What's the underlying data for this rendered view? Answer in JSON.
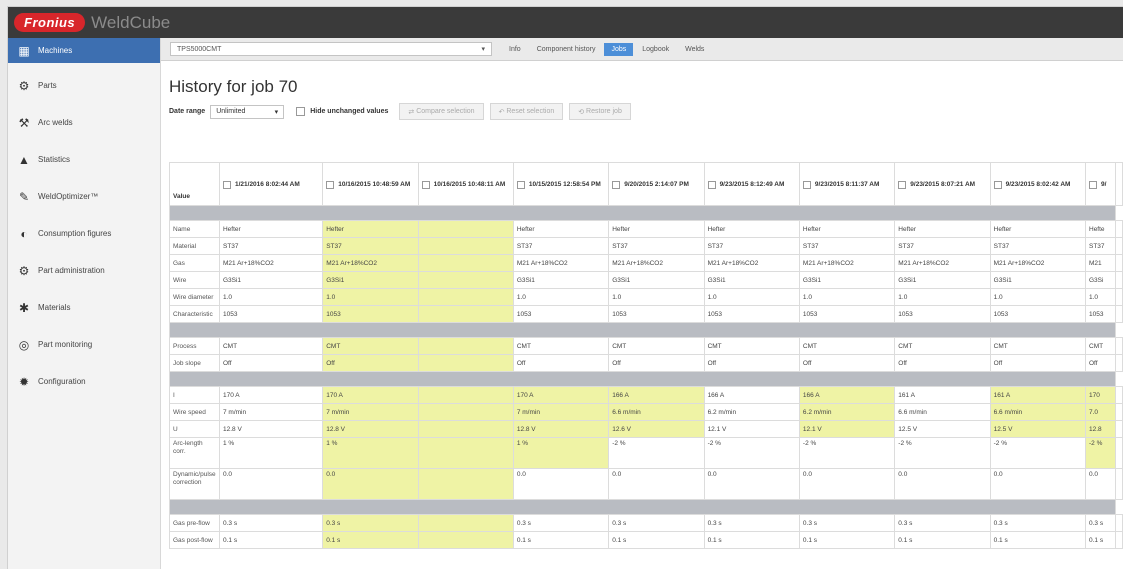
{
  "app": {
    "logo": "Fronius",
    "name": "WeldCube"
  },
  "sidebar": {
    "items": [
      {
        "icon": "machines-icon",
        "label": "Machines",
        "active": true
      },
      {
        "icon": "parts-icon",
        "label": "Parts"
      },
      {
        "icon": "arc-welds-icon",
        "label": "Arc welds"
      },
      {
        "icon": "statistics-icon",
        "label": "Statistics"
      },
      {
        "icon": "weldoptimizer-icon",
        "label": "WeldOptimizer™"
      },
      {
        "icon": "consumption-icon",
        "label": "Consumption figures"
      },
      {
        "icon": "part-administration-icon",
        "label": "Part administration"
      },
      {
        "icon": "materials-icon",
        "label": "Materials"
      },
      {
        "icon": "part-monitoring-icon",
        "label": "Part monitoring"
      },
      {
        "icon": "configuration-icon",
        "label": "Configuration"
      }
    ]
  },
  "toolbar": {
    "machine": "TPS5000CMT",
    "tabs": [
      {
        "label": "Info"
      },
      {
        "label": "Component history"
      },
      {
        "label": "Jobs",
        "active": true
      },
      {
        "label": "Logbook"
      },
      {
        "label": "Welds"
      }
    ]
  },
  "page": {
    "title": "History for job 70",
    "date_range_label": "Date range",
    "date_range_value": "Unlimited",
    "hide_unchanged_label": "Hide unchanged values",
    "buttons": [
      "Compare selection",
      "Reset selection",
      "Restore job"
    ]
  },
  "table": {
    "value_header": "Value",
    "columns": [
      {
        "date": "1/21/2016 8:02:44 AM",
        "highlight": false
      },
      {
        "date": "10/16/2015 10:48:59 AM",
        "highlight": true
      },
      {
        "date": "10/16/2015 10:48:11 AM",
        "highlight": true
      },
      {
        "date": "10/15/2015 12:58:54 PM",
        "highlight": false
      },
      {
        "date": "9/20/2015 2:14:07 PM",
        "highlight": false
      },
      {
        "date": "9/23/2015 8:12:49 AM",
        "highlight": false
      },
      {
        "date": "9/23/2015 8:11:37 AM",
        "highlight": false
      },
      {
        "date": "9/23/2015 8:07:21 AM",
        "highlight": false
      },
      {
        "date": "9/23/2015 8:02:42 AM",
        "highlight": false
      },
      {
        "date": "9/",
        "highlight": false
      }
    ],
    "sections": [
      {
        "title": "",
        "rows": [
          {
            "label": "Name",
            "values": [
              "Hefter",
              "Hefter",
              "",
              "Hefter",
              "Hefter",
              "Hefter",
              "Hefter",
              "Hefter",
              "Hefter",
              "Hefte"
            ]
          },
          {
            "label": "Material",
            "values": [
              "ST37",
              "ST37",
              "",
              "ST37",
              "ST37",
              "ST37",
              "ST37",
              "ST37",
              "ST37",
              "ST37"
            ]
          },
          {
            "label": "Gas",
            "values": [
              "M21 Ar+18%CO2",
              "M21 Ar+18%CO2",
              "",
              "M21 Ar+18%CO2",
              "M21 Ar+18%CO2",
              "M21 Ar+18%CO2",
              "M21 Ar+18%CO2",
              "M21 Ar+18%CO2",
              "M21 Ar+18%CO2",
              "M21"
            ]
          },
          {
            "label": "Wire",
            "values": [
              "G3Si1",
              "G3Si1",
              "",
              "G3Si1",
              "G3Si1",
              "G3Si1",
              "G3Si1",
              "G3Si1",
              "G3Si1",
              "G3Si"
            ]
          },
          {
            "label": "Wire diameter",
            "values": [
              "1.0",
              "1.0",
              "",
              "1.0",
              "1.0",
              "1.0",
              "1.0",
              "1.0",
              "1.0",
              "1.0"
            ]
          },
          {
            "label": "Characteristic",
            "values": [
              "1053",
              "1053",
              "",
              "1053",
              "1053",
              "1053",
              "1053",
              "1053",
              "1053",
              "1053"
            ]
          }
        ]
      },
      {
        "title": "",
        "rows": [
          {
            "label": "Process",
            "values": [
              "CMT",
              "CMT",
              "",
              "CMT",
              "CMT",
              "CMT",
              "CMT",
              "CMT",
              "CMT",
              "CMT"
            ]
          },
          {
            "label": "Job slope",
            "values": [
              "Off",
              "Off",
              "",
              "Off",
              "Off",
              "Off",
              "Off",
              "Off",
              "Off",
              "Off"
            ]
          }
        ]
      },
      {
        "title": "",
        "rows": [
          {
            "label": "I",
            "values": [
              "170 A",
              "170 A",
              "",
              "170 A",
              "166 A",
              "166 A",
              "166 A",
              "161 A",
              "161 A",
              "170"
            ],
            "hl": [
              false,
              true,
              true,
              true,
              true,
              false,
              true,
              false,
              true,
              true
            ]
          },
          {
            "label": "Wire speed",
            "values": [
              "7 m/min",
              "7 m/min",
              "",
              "7 m/min",
              "6.6 m/min",
              "6.2 m/min",
              "6.2 m/min",
              "6.6 m/min",
              "6.6 m/min",
              "7.0"
            ],
            "hl": [
              false,
              true,
              true,
              true,
              true,
              false,
              true,
              false,
              true,
              true
            ]
          },
          {
            "label": "U",
            "values": [
              "12.8 V",
              "12.8 V",
              "",
              "12.8 V",
              "12.6 V",
              "12.1 V",
              "12.1 V",
              "12.5 V",
              "12.5 V",
              "12.8"
            ],
            "hl": [
              false,
              true,
              true,
              true,
              true,
              false,
              true,
              false,
              true,
              true
            ]
          },
          {
            "label": "Arc-length corr.",
            "values": [
              "1 %",
              "1 %",
              "",
              "1 %",
              "-2 %",
              "-2 %",
              "-2 %",
              "-2 %",
              "-2 %",
              "-2 %"
            ],
            "hl": [
              false,
              true,
              true,
              true,
              false,
              false,
              false,
              false,
              false,
              true
            ],
            "tall": true
          },
          {
            "label": "Dynamic/pulse correction",
            "values": [
              "0.0",
              "0.0",
              "",
              "0.0",
              "0.0",
              "0.0",
              "0.0",
              "0.0",
              "0.0",
              "0.0"
            ],
            "hl": [
              false,
              true,
              true,
              false,
              false,
              false,
              false,
              false,
              false,
              false
            ],
            "tall": true
          }
        ]
      },
      {
        "title": "",
        "rows": [
          {
            "label": "Gas pre-flow",
            "values": [
              "0.3 s",
              "0.3 s",
              "",
              "0.3 s",
              "0.3 s",
              "0.3 s",
              "0.3 s",
              "0.3 s",
              "0.3 s",
              "0.3 s"
            ]
          },
          {
            "label": "Gas post-flow",
            "values": [
              "0.1 s",
              "0.1 s",
              "",
              "0.1 s",
              "0.1 s",
              "0.1 s",
              "0.1 s",
              "0.1 s",
              "0.1 s",
              "0.1 s"
            ]
          }
        ]
      }
    ]
  }
}
